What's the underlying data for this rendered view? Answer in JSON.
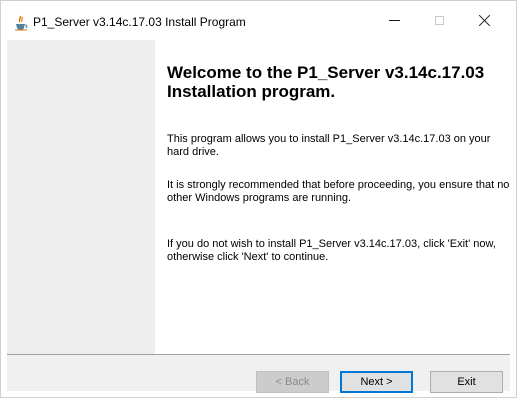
{
  "window": {
    "title": "P1_Server v3.14c.17.03 Install Program",
    "app_icon": "java-cup-icon"
  },
  "title_bar_buttons": {
    "minimize": "minimize-icon",
    "maximize": "maximize-icon",
    "close": "close-icon"
  },
  "content": {
    "heading": "Welcome to the P1_Server v3.14c.17.03 Installation program.",
    "paragraphs": [
      "This program allows you to install P1_Server v3.14c.17.03 on your hard drive.",
      "It is strongly recommended that before proceeding, you ensure that no other Windows programs are running.",
      "If you do not wish to install P1_Server v3.14c.17.03, click 'Exit' now, otherwise click 'Next' to continue."
    ]
  },
  "buttons": {
    "back": "< Back",
    "next": "Next >",
    "exit": "Exit"
  },
  "colors": {
    "side_panel": "#eeeeee",
    "footer": "#f0f0f0",
    "accent": "#0078d7"
  }
}
